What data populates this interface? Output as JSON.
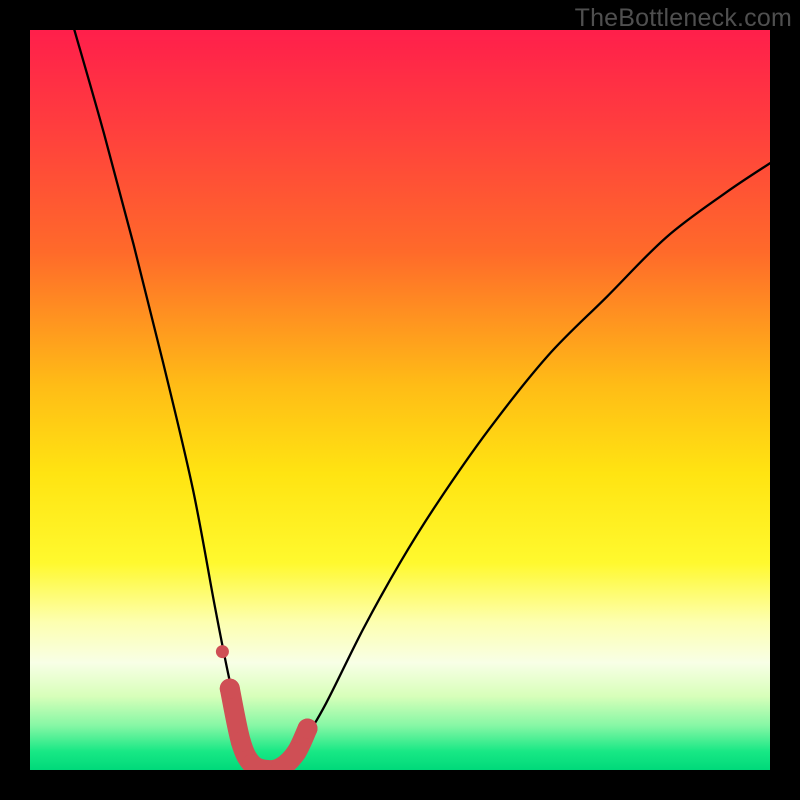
{
  "watermark": "TheBottleneck.com",
  "chart_data": {
    "type": "line",
    "title": "",
    "xlabel": "",
    "ylabel": "",
    "xlim": [
      0,
      100
    ],
    "ylim": [
      0,
      100
    ],
    "gradient_stops": [
      {
        "offset": 0.0,
        "color": "#ff1f4b"
      },
      {
        "offset": 0.12,
        "color": "#ff3b3f"
      },
      {
        "offset": 0.3,
        "color": "#ff6a2a"
      },
      {
        "offset": 0.48,
        "color": "#ffbc16"
      },
      {
        "offset": 0.6,
        "color": "#ffe412"
      },
      {
        "offset": 0.72,
        "color": "#fff92e"
      },
      {
        "offset": 0.8,
        "color": "#fdffb0"
      },
      {
        "offset": 0.855,
        "color": "#f8ffe6"
      },
      {
        "offset": 0.9,
        "color": "#d8ffba"
      },
      {
        "offset": 0.94,
        "color": "#86f7a5"
      },
      {
        "offset": 0.975,
        "color": "#18e885"
      },
      {
        "offset": 1.0,
        "color": "#00d97a"
      }
    ],
    "series": [
      {
        "name": "bottleneck-curve",
        "x": [
          6,
          10,
          14,
          18,
          22,
          25,
          27,
          29,
          30.5,
          32,
          34,
          37,
          40,
          45,
          50,
          55,
          62,
          70,
          78,
          86,
          94,
          100
        ],
        "y": [
          100,
          86,
          71,
          55,
          38,
          22,
          12,
          4,
          0,
          0,
          0,
          4,
          9,
          19,
          28,
          36,
          46,
          56,
          64,
          72,
          78,
          82
        ]
      }
    ],
    "marker_series": {
      "name": "highlight-band",
      "color": "#cf4f55",
      "x": [
        27.0,
        28.5,
        30.0,
        32.0,
        34.0,
        36.0,
        37.5
      ],
      "y": [
        11.0,
        3.8,
        0.8,
        0.0,
        0.4,
        2.4,
        5.6
      ]
    },
    "extra_markers": [
      {
        "name": "outlier-dot",
        "color": "#cf4f55",
        "x": 26.0,
        "y": 16.0
      }
    ]
  }
}
